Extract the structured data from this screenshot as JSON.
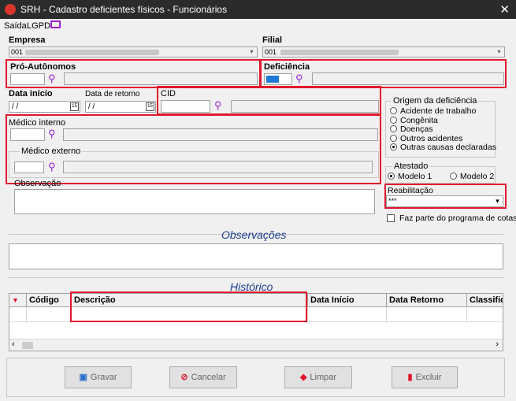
{
  "window": {
    "title": "SRH - Cadastro deficientes físicos - Funcionários",
    "close": "✕"
  },
  "menu": {
    "saida": "Saída",
    "lgpd": "LGPD"
  },
  "empresa": {
    "label": "Empresa",
    "value": "001"
  },
  "filial": {
    "label": "Filial",
    "value": "001"
  },
  "pro_autonomos": {
    "label": "Pró-Autônomos"
  },
  "deficiencia": {
    "label": "Deficiência"
  },
  "data_inicio": {
    "label": "Data início",
    "value": " / /"
  },
  "data_retorno": {
    "label": "Data de retorno",
    "value": " / /"
  },
  "cid": {
    "label": "CID"
  },
  "medico_interno": {
    "label": "Médico interno"
  },
  "medico_externo": {
    "label": "Médico externo"
  },
  "observacao": {
    "label": "Observação"
  },
  "origem": {
    "title": "Origem da deficiência",
    "options": [
      "Acidente de trabalho",
      "Congênita",
      "Doenças",
      "Outros acidentes",
      "Outras causas declaradas"
    ],
    "selected": "Outras causas declaradas"
  },
  "atestado": {
    "title": "Atestado",
    "options": [
      "Modelo 1",
      "Modelo 2"
    ],
    "selected": "Modelo 1"
  },
  "reabilitacao": {
    "label": "Reabilitação",
    "value": "***"
  },
  "cotas": {
    "label": "Faz parte do programa de cotas"
  },
  "observacoes_title": "Observações",
  "historico": {
    "title": "Histórico",
    "columns": [
      "Código",
      "Descrição",
      "Data Início",
      "Data Retorno",
      "Classifica"
    ]
  },
  "buttons": {
    "gravar": "Gravar",
    "cancelar": "Cancelar",
    "limpar": "Limpar",
    "excluir": "Excluir"
  },
  "colors": {
    "highlight": "#e0182d",
    "section_title": "#1c3f8f",
    "search_icon": "#a020d0",
    "deficiencia_fill": "#1e7ad4"
  }
}
